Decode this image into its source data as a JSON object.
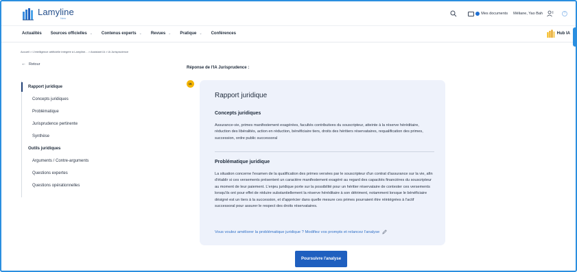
{
  "header": {
    "logo_name": "Lamyline",
    "logo_sub": "New",
    "docs_label": "Mes documents",
    "user_name": "Méliane, Yao Bah",
    "help_glyph": "?"
  },
  "nav": {
    "items": [
      {
        "label": "Actualités",
        "has_menu": false
      },
      {
        "label": "Sources officielles",
        "has_menu": true
      },
      {
        "label": "Contenus experts",
        "has_menu": true
      },
      {
        "label": "Revues",
        "has_menu": true
      },
      {
        "label": "Pratique",
        "has_menu": true
      },
      {
        "label": "Conférences",
        "has_menu": false
      }
    ],
    "chevron": "⌄",
    "hub_label": "Hub IA"
  },
  "breadcrumb": "Accueil > L'intelligence artificielle intégrée à Lamyline... > Assistant IA > IA Jurisprudence",
  "back_label": "Retour",
  "back_arrow": "←",
  "toc": {
    "sections": [
      {
        "title": "Rapport juridique",
        "items": [
          "Concepts juridiques",
          "Problématique",
          "Jurisprudence pertinente",
          "Synthèse"
        ]
      },
      {
        "title": "Outils juridiques",
        "items": [
          "Arguments / Contre-arguments",
          "Questions expertes",
          "Questions opérationnelles"
        ]
      }
    ]
  },
  "response_title": "Réponse de l'IA Jurisprudence :",
  "ia_badge": "IA",
  "report": {
    "title": "Rapport juridique",
    "concepts_title": "Concepts juridiques",
    "concepts_text": "Assurance-vie, primes manifestement exagérées, facultés contributives du souscripteur, atteinte à la réserve héréditaire, réduction des libéralités, action en réduction, bénéficiaire tiers, droits des héritiers réservataires, requalification des primes, succession, ordre public successoral",
    "problem_title": "Problématique juridique",
    "problem_text": "La situation concerne l'examen de la qualification des primes versées par le souscripteur d'un contrat d'assurance sur la vie, afin d'établir si ces versements présentent un caractère manifestement exagéré au regard des capacités financières du souscripteur au moment de leur paiement. L'enjeu juridique porte sur la possibilité pour un héritier réservataire de contester ces versements lorsqu'ils ont pour effet de réduire substantiellement la réserve héréditaire à son détriment, notamment lorsque le bénéficiaire désigné est un tiers à la succession, et d'apprécier dans quelle mesure ces primes pourraient être réintégrées à l'actif successoral pour assurer le respect des droits réservataires.",
    "improve_text": "Vous voulez améliorer la problématique juridique ? Modifiez vos prompts et relancez l'analyse"
  },
  "continue_button": "Poursuivre l'analyse",
  "colors": {
    "accent": "#1f5fbf",
    "card_bg": "#eef2fb",
    "badge": "#f4b400",
    "frame": "#2b8fe0"
  }
}
